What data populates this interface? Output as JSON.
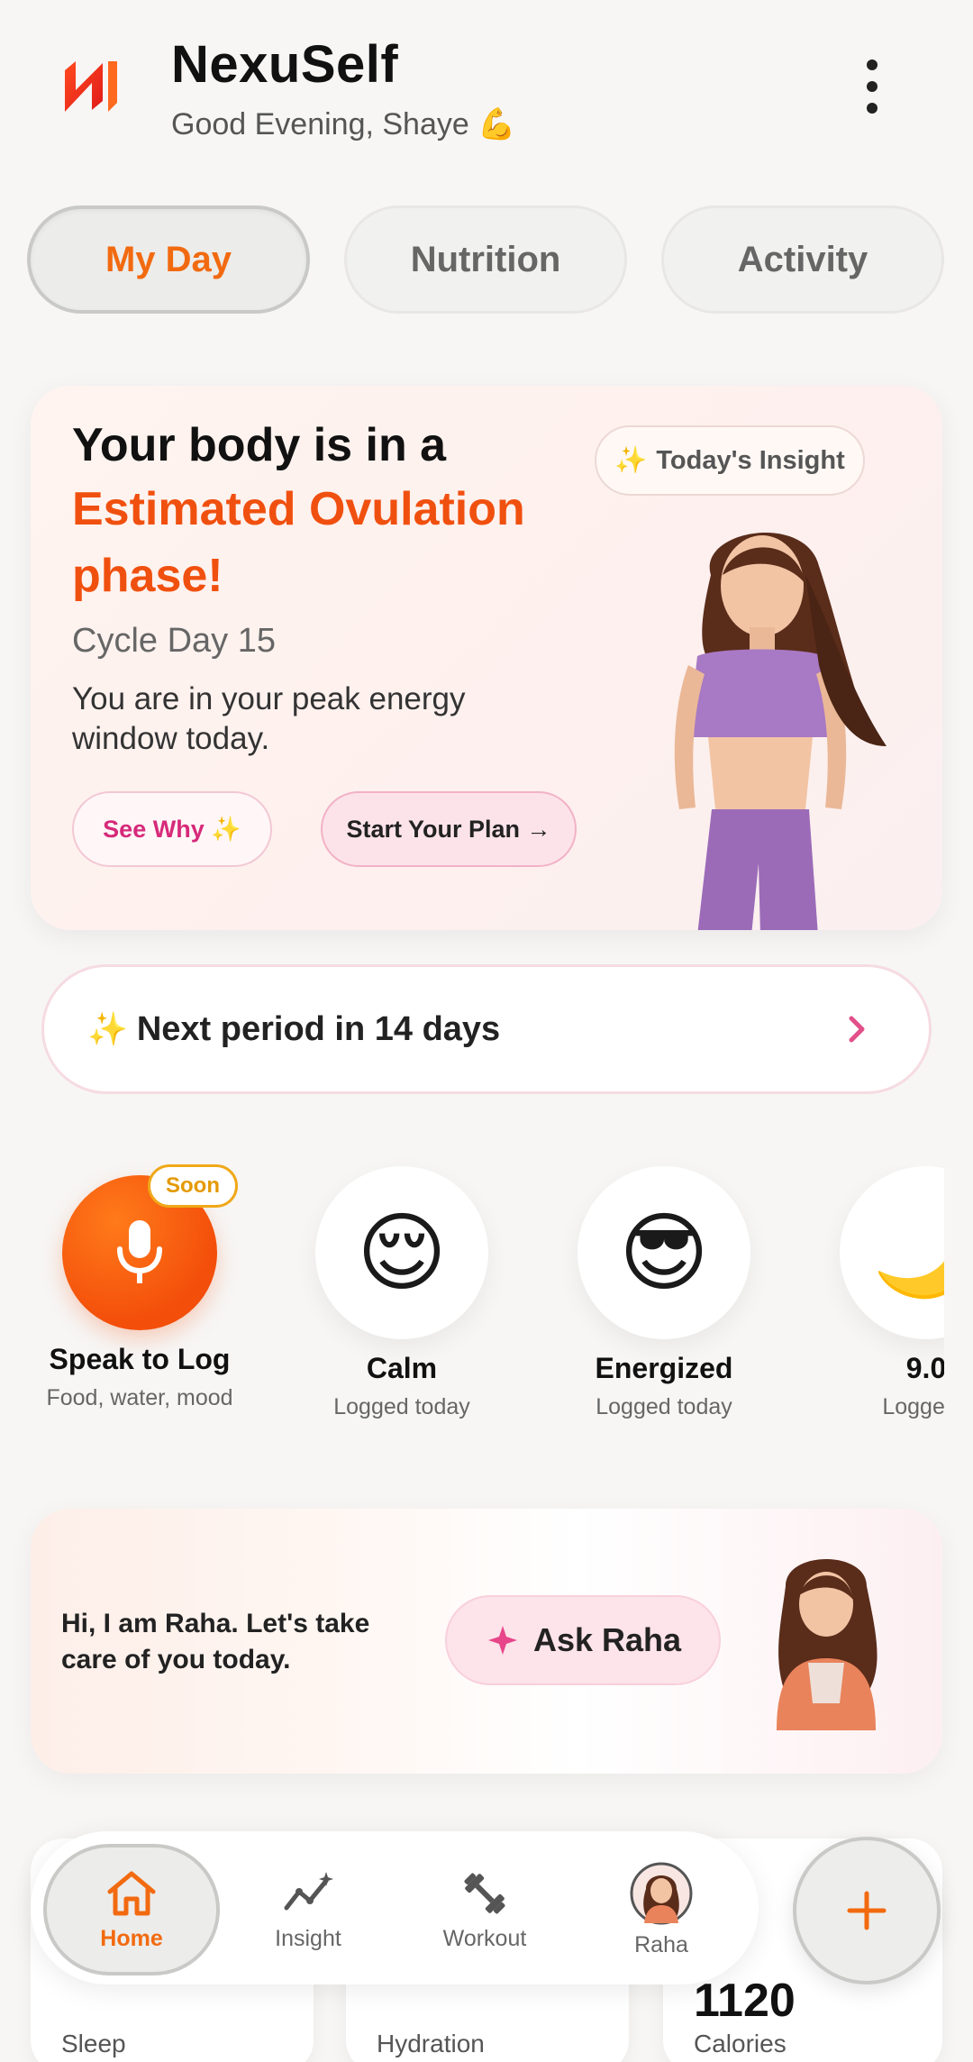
{
  "colors": {
    "accent": "#f26a10",
    "brand_red": "#f0500f",
    "pink": "#d62a7a",
    "soon": "#e49a06"
  },
  "header": {
    "app_name": "NexuSelf",
    "greeting": "Good Evening, Shaye 💪",
    "logo_icon": "nexuself-logo",
    "menu_icon": "more-vertical-icon"
  },
  "tabs": [
    {
      "label": "My Day",
      "active": true
    },
    {
      "label": "Nutrition",
      "active": false
    },
    {
      "label": "Activity",
      "active": false
    }
  ],
  "hero": {
    "line1": "Your body is in a",
    "line2": "Estimated Ovulation phase!",
    "cycle_day": "Cycle Day 15",
    "description": "You are in your peak energy window today.",
    "see_why": "See Why ✨",
    "start_plan": "Start Your Plan →",
    "insight_chip": "Today's Insight",
    "insight_icon": "✨"
  },
  "next_period": {
    "icon": "✨",
    "text": "Next period in 14 days"
  },
  "quick_logs": [
    {
      "type": "voice",
      "label": "Speak to Log",
      "sub": "Food, water, mood",
      "badge": "Soon"
    },
    {
      "type": "mood",
      "emoji": "😌",
      "label": "Calm",
      "sub": "Logged today"
    },
    {
      "type": "mood",
      "emoji": "😎",
      "label": "Energized",
      "sub": "Logged today"
    },
    {
      "type": "sleep",
      "emoji": "🌙",
      "label": "9.0",
      "sub": "Logged t"
    }
  ],
  "raha": {
    "message": "Hi, I am Raha. Let's take care of you today.",
    "button": "Ask Raha"
  },
  "stats": [
    {
      "value": "",
      "label": "Sleep"
    },
    {
      "value": "",
      "label": "Hydration"
    },
    {
      "value": "1120",
      "label": "Calories"
    }
  ],
  "nav": [
    {
      "label": "Home",
      "icon": "home-icon",
      "active": true
    },
    {
      "label": "Insight",
      "icon": "trend-icon",
      "active": false
    },
    {
      "label": "Workout",
      "icon": "dumbbell-icon",
      "active": false
    },
    {
      "label": "Raha",
      "icon": "raha-avatar",
      "active": false
    }
  ],
  "fab_icon": "plus-icon"
}
